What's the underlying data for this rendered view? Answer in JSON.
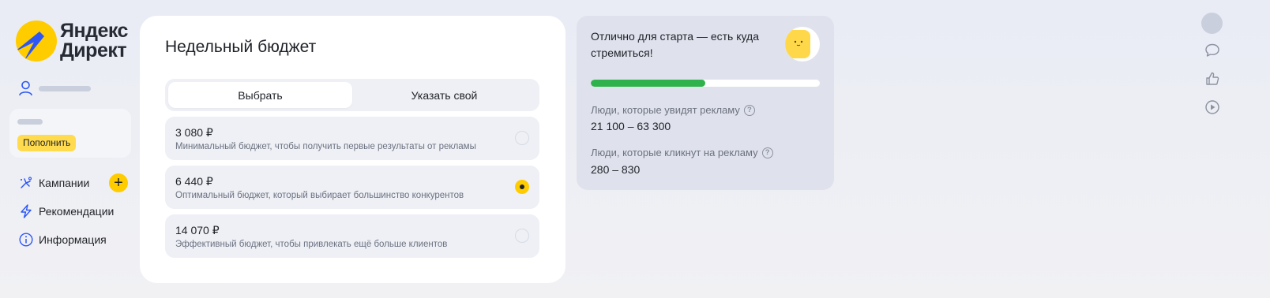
{
  "app": {
    "logo_line1": "Яндекс",
    "logo_line2": "Директ"
  },
  "sidebar": {
    "topup_label": "Пополнить",
    "nav": [
      {
        "label": "Кампании",
        "icon": "campaigns-icon"
      },
      {
        "label": "Рекомендации",
        "icon": "lightning-icon"
      },
      {
        "label": "Информация",
        "icon": "info-icon"
      }
    ]
  },
  "budget": {
    "title": "Недельный бюджет",
    "tabs": [
      {
        "label": "Выбрать",
        "active": true
      },
      {
        "label": "Указать свой",
        "active": false
      }
    ],
    "options": [
      {
        "amount": "3 080 ₽",
        "description": "Минимальный бюджет, чтобы получить первые результаты от рекламы",
        "selected": false
      },
      {
        "amount": "6 440 ₽",
        "description": "Оптимальный бюджет, который выбирает большинство конкурентов",
        "selected": true
      },
      {
        "amount": "14 070 ₽",
        "description": "Эффективный бюджет, чтобы привлекать ещё больше клиентов",
        "selected": false
      }
    ]
  },
  "forecast": {
    "title": "Отлично для старта — есть куда стремиться!",
    "progress_fraction": 0.5,
    "reach_label": "Люди, которые увидят рекламу",
    "reach_value": "21 100 – 63 300",
    "clicks_label": "Люди, которые кликнут на рекламу",
    "clicks_value": "280 – 830",
    "help_glyph": "?"
  },
  "colors": {
    "accent_yellow": "#ffcc00",
    "progress_green": "#2fb24c",
    "card_bg": "#ffffff",
    "forecast_bg": "#dfe2ec"
  },
  "rail": {
    "icons": [
      "avatar",
      "chat-icon",
      "thumbs-up-icon",
      "play-icon"
    ]
  }
}
